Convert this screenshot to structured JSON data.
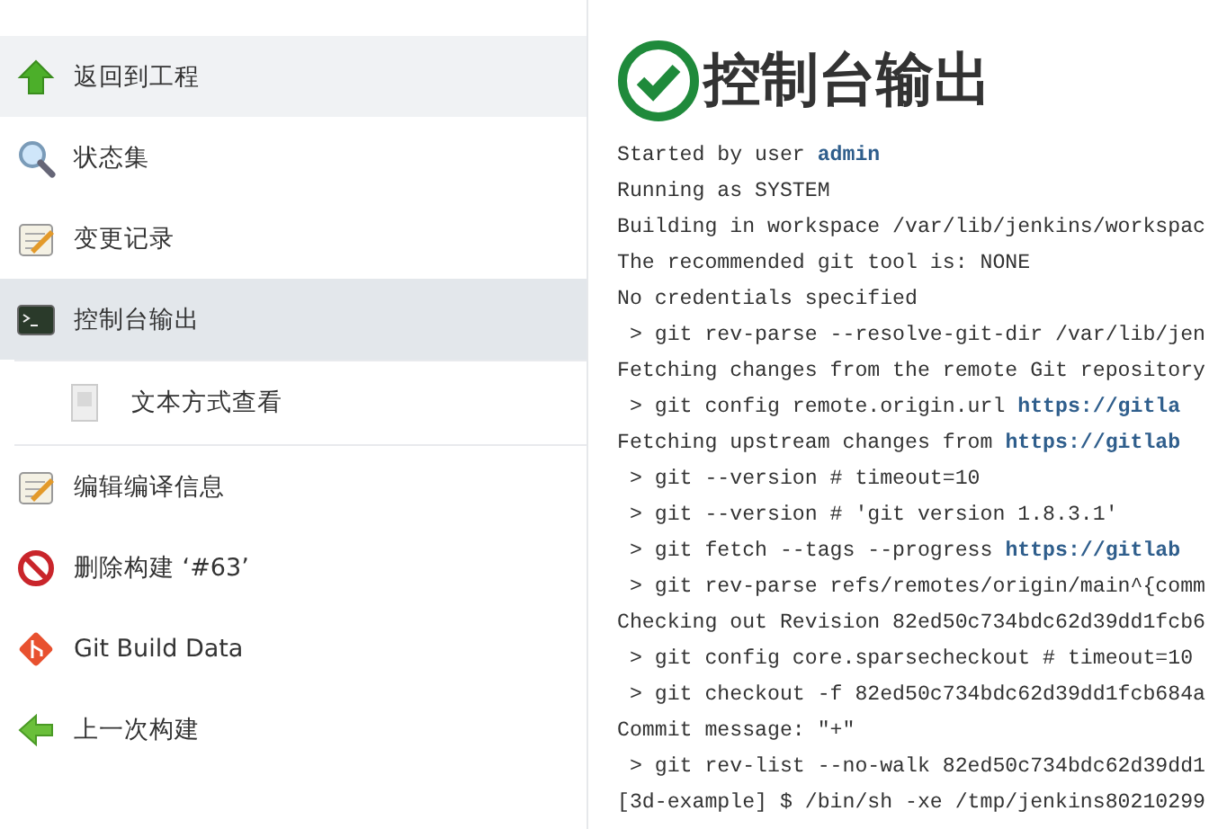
{
  "sidebar": {
    "items": [
      {
        "kind": "up-arrow",
        "label": "返回到工程",
        "selected": false,
        "hovered": true,
        "sub": false
      },
      {
        "kind": "magnifier",
        "label": "状态集",
        "selected": false,
        "hovered": false,
        "sub": false
      },
      {
        "kind": "notepad",
        "label": "变更记录",
        "selected": false,
        "hovered": false,
        "sub": false
      },
      {
        "kind": "terminal",
        "label": "控制台输出",
        "selected": true,
        "hovered": false,
        "sub": false
      },
      {
        "kind": "document",
        "label": "文本方式查看",
        "selected": false,
        "hovered": false,
        "sub": true
      },
      {
        "kind": "notepad",
        "label": "编辑编译信息",
        "selected": false,
        "hovered": false,
        "sub": false
      },
      {
        "kind": "forbidden",
        "label": "删除构建 ‘#63’",
        "selected": false,
        "hovered": false,
        "sub": false
      },
      {
        "kind": "git",
        "label": "Git Build Data",
        "selected": false,
        "hovered": false,
        "sub": false
      },
      {
        "kind": "left-arrow",
        "label": "上一次构建",
        "selected": false,
        "hovered": false,
        "sub": false
      }
    ]
  },
  "main": {
    "title": "控制台输出",
    "kind": "success",
    "console": [
      {
        "text": "Started by user ",
        "link": "admin"
      },
      {
        "text": "Running as SYSTEM"
      },
      {
        "text": "Building in workspace /var/lib/jenkins/workspac"
      },
      {
        "text": "The recommended git tool is: NONE"
      },
      {
        "text": "No credentials specified"
      },
      {
        "text": " > git rev-parse --resolve-git-dir /var/lib/jen"
      },
      {
        "text": "Fetching changes from the remote Git repository"
      },
      {
        "text": " > git config remote.origin.url ",
        "link": "https://gitla"
      },
      {
        "text": "Fetching upstream changes from ",
        "link": "https://gitlab"
      },
      {
        "text": " > git --version # timeout=10"
      },
      {
        "text": " > git --version # 'git version 1.8.3.1'"
      },
      {
        "text": " > git fetch --tags --progress ",
        "link": "https://gitlab"
      },
      {
        "text": " > git rev-parse refs/remotes/origin/main^{comm"
      },
      {
        "text": "Checking out Revision 82ed50c734bdc62d39dd1fcb6"
      },
      {
        "text": " > git config core.sparsecheckout # timeout=10"
      },
      {
        "text": " > git checkout -f 82ed50c734bdc62d39dd1fcb684a"
      },
      {
        "text": "Commit message: \"+\""
      },
      {
        "text": " > git rev-list --no-walk 82ed50c734bdc62d39dd1"
      },
      {
        "text": "[3d-example] $ /bin/sh -xe /tmp/jenkins80210299"
      }
    ]
  }
}
